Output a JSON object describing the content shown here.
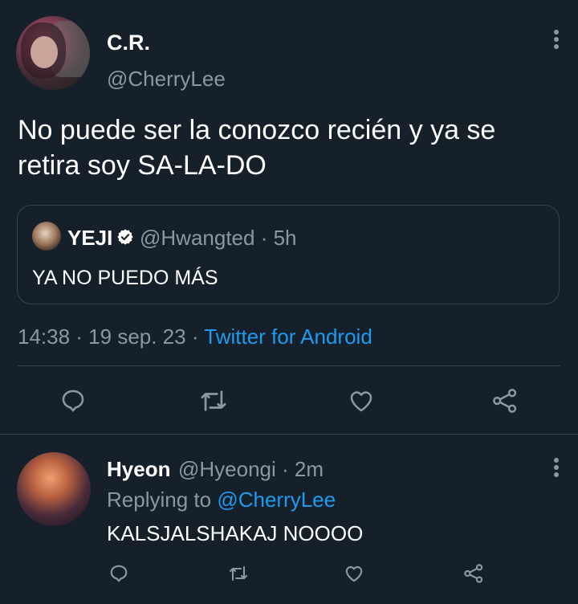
{
  "tweet": {
    "display_name": "C.R.",
    "handle": "@CherryLee",
    "text": "No puede ser la conozco recién y ya se retira soy SA-LA-DO",
    "timestamp": "14:38 · 19 sep. 23 · ",
    "source": "Twitter for Android"
  },
  "quote": {
    "display_name": "YEJI",
    "handle": "@Hwangted",
    "time": "· 5h",
    "text": "YA NO PUEDO MÁS",
    "verified": true
  },
  "reply": {
    "display_name": "Hyeon",
    "handle": "@Hyeongi",
    "time": "· 2m",
    "replying_prefix": "Replying to ",
    "replying_to": "@CherryLee",
    "text": "KALSJALSHAKAJ NOOOO"
  },
  "actions": [
    "reply-icon",
    "retweet-icon",
    "like-icon",
    "share-icon"
  ],
  "colors": {
    "background": "#15202b",
    "secondary_text": "#8899a6",
    "link": "#1d9bf0",
    "border": "#38444d"
  }
}
